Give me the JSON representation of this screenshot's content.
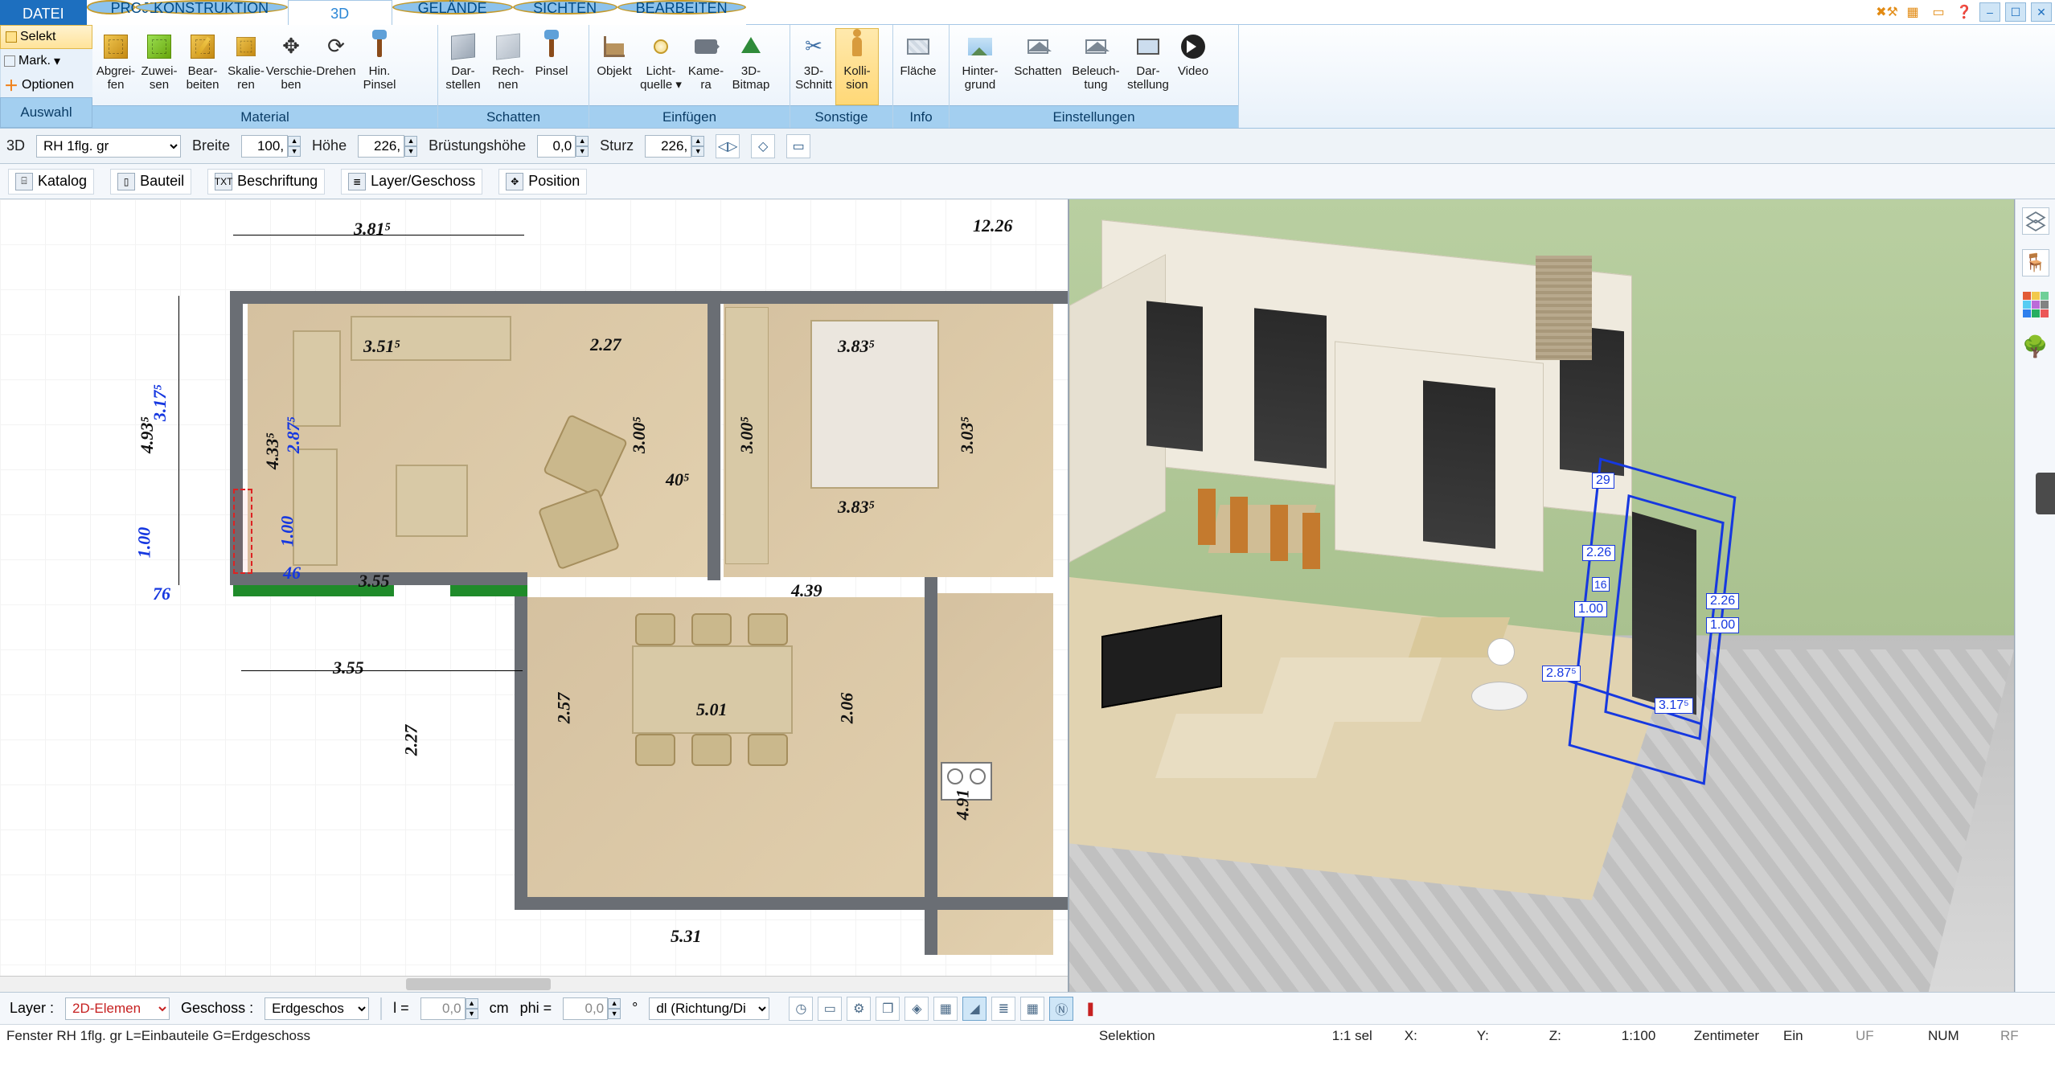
{
  "tabs": {
    "datei": "DATEI",
    "projekt": "PROJEKT",
    "konstruktion": "KONSTRUKTION",
    "d3": "3D",
    "gelaende": "GELÄNDE",
    "sichten": "SICHTEN",
    "bearbeiten": "BEARBEITEN"
  },
  "leftcol": {
    "selekt": "Selekt",
    "mark": "Mark.",
    "optionen": "Optionen",
    "auswahl": "Auswahl"
  },
  "groups": {
    "material": "Material",
    "schatten": "Schatten",
    "einfuegen": "Einfügen",
    "sonstige": "Sonstige",
    "info": "Info",
    "einstellungen": "Einstellungen"
  },
  "ribbon": {
    "abgreifen": "Abgrei-\nfen",
    "zuweisen": "Zuwei-\nsen",
    "bearbeiten": "Bear-\nbeiten",
    "skalieren": "Skalie-\nren",
    "verschieben": "Verschie-\nben",
    "drehen": "Drehen",
    "hinpinsel": "Hin.\nPinsel",
    "darstellen": "Dar-\nstellen",
    "rechnen": "Rech-\nnen",
    "pinsel": "Pinsel",
    "objekt": "Objekt",
    "lichtquelle": "Licht-\nquelle ▾",
    "kamera": "Kame-\nra",
    "bitmap3d": "3D-\nBitmap",
    "schnitt3d": "3D-\nSchnitt",
    "kollision": "Kolli-\nsion",
    "flaeche": "Fläche",
    "hintergrund": "Hinter-\ngrund",
    "schattenS": "Schatten",
    "beleuchtung": "Beleuch-\ntung",
    "darstellung": "Dar-\nstellung",
    "video": "Video"
  },
  "prop": {
    "mode": "3D",
    "type": "RH 1flg. gr",
    "breite_lbl": "Breite",
    "breite": "100,",
    "hoehe_lbl": "Höhe",
    "hoehe": "226,",
    "bh_lbl": "Brüstungshöhe",
    "bh": "0,0",
    "sturz_lbl": "Sturz",
    "sturz": "226,"
  },
  "tool": {
    "katalog": "Katalog",
    "bauteil": "Bauteil",
    "beschriftung": "Beschriftung",
    "layer": "Layer/Geschoss",
    "position": "Position"
  },
  "dims2d": {
    "d3815": "3.81⁵",
    "d1226": "12.26",
    "d3515": "3.51⁵",
    "d227": "2.27",
    "d3835": "3.83⁵",
    "d3005": "3.00⁵",
    "d3005b": "3.00⁵",
    "d3035": "3.03⁵",
    "d405": "40⁵",
    "d287": "2.87⁵",
    "d4335": "4.33⁵",
    "d100": "1.00",
    "d46": "46",
    "d4935": "4.93⁵",
    "d3175": "3.17⁵",
    "d76": "76",
    "d355": "3.55",
    "d355b": "3.55",
    "d439": "4.39",
    "d257": "2.57",
    "d206": "2.06",
    "d501": "5.01",
    "d531": "5.31",
    "d227b": "2.27",
    "d3835b": "3.83⁵",
    "d491": "4.91"
  },
  "labels3d": {
    "a": "2.26",
    "b": "1.00",
    "c": "2.87⁵",
    "d": "3.17⁵",
    "e": "2.26",
    "f": "1.00",
    "g": "29",
    "h": "16"
  },
  "opt": {
    "layer_lbl": "Layer :",
    "layer_val": "2D-Elemen",
    "geschoss_lbl": "Geschoss :",
    "geschoss_val": "Erdgeschos",
    "l_lbl": "l =",
    "l_val": "0,0",
    "cm": "cm",
    "phi_lbl": "phi =",
    "phi_val": "0,0",
    "deg": "°",
    "dl": "dl (Richtung/Di"
  },
  "status": {
    "left": "Fenster RH 1flg. gr L=Einbauteile G=Erdgeschoss",
    "selektion": "Selektion",
    "sel": "1:1 sel",
    "x": "X:",
    "y": "Y:",
    "z": "Z:",
    "scale": "1:100",
    "unit": "Zentimeter",
    "ein": "Ein",
    "uf": "UF",
    "num": "NUM",
    "rf": "RF"
  }
}
